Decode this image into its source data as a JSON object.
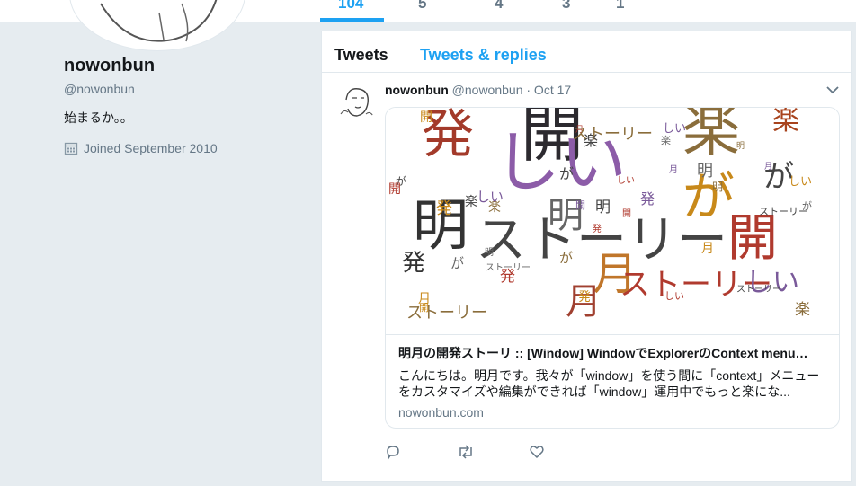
{
  "stats": {
    "values": [
      "104",
      "5",
      "4",
      "3",
      "1"
    ]
  },
  "profile": {
    "name": "nowonbun",
    "handle": "@nowonbun",
    "bio": "始まるか。。",
    "joined": "Joined September 2010"
  },
  "tabs": {
    "tweets": "Tweets",
    "replies": "Tweets & replies"
  },
  "tweet": {
    "name": "nowonbun",
    "handle": "@nowonbun",
    "date": "· Oct 17",
    "card": {
      "title": "明月の開発ストーリ :: [Window] WindowでExplorerのContext menu…",
      "description": "こんにちは。明月です。我々が「window」を使う間に「context」メニューをカスタマイズや編集ができれば「window」運用中でもっと楽にな...",
      "domain": "nowonbun.com"
    }
  },
  "wordcloud": {
    "words": [
      {
        "t": "開",
        "c": "#2c2a2f"
      },
      {
        "t": "楽",
        "c": "#8a6d3b"
      },
      {
        "t": "発",
        "c": "#a33a2a"
      },
      {
        "t": "しい",
        "c": "#8c5ca8"
      },
      {
        "t": "明",
        "c": "#333333"
      },
      {
        "t": "ストーリー",
        "c": "#444444"
      },
      {
        "t": "が",
        "c": "#c8891a"
      },
      {
        "t": "開",
        "c": "#b03a2e"
      },
      {
        "t": "月",
        "c": "#c0762a"
      },
      {
        "t": "明",
        "c": "#666666"
      },
      {
        "t": "楽",
        "c": "#a8431d"
      },
      {
        "t": "が",
        "c": "#444444"
      },
      {
        "t": "ストーリー",
        "c": "#b03a2e"
      },
      {
        "t": "しい",
        "c": "#7a5a9a"
      },
      {
        "t": "月",
        "c": "#a04030"
      },
      {
        "t": "発",
        "c": "#333333"
      }
    ]
  },
  "colors": {
    "accent": "#1da1f2",
    "background": "#e6ecf0"
  }
}
